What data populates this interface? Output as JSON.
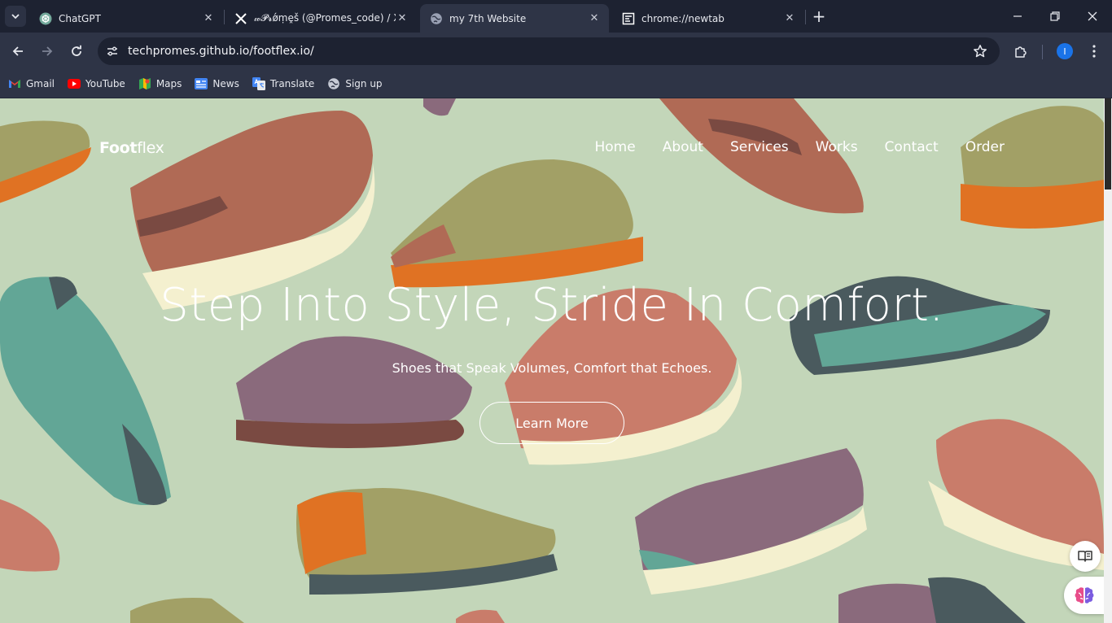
{
  "tabs": [
    {
      "title": "ChatGPT",
      "icon": "chatgpt-icon"
    },
    {
      "title": "𝓌𝓟𝓻ǿṃḙṧ (@Promes_code) / X",
      "icon": "x-logo-icon"
    },
    {
      "title": "my 7th Website",
      "icon": "globe-icon",
      "active": true
    },
    {
      "title": "chrome://newtab",
      "icon": "newtab-icon"
    }
  ],
  "address_bar": {
    "url": "techpromes.github.io/footflex.io/"
  },
  "profile": {
    "initial": "I"
  },
  "bookmarks": [
    {
      "label": "Gmail",
      "icon": "gmail-icon"
    },
    {
      "label": "YouTube",
      "icon": "youtube-icon"
    },
    {
      "label": "Maps",
      "icon": "maps-icon"
    },
    {
      "label": "News",
      "icon": "news-icon"
    },
    {
      "label": "Translate",
      "icon": "translate-icon"
    },
    {
      "label": "Sign up",
      "icon": "globe-icon"
    }
  ],
  "site": {
    "logo_bold": "Foot",
    "logo_light": "flex",
    "nav": [
      "Home",
      "About",
      "Services",
      "Works",
      "Contact",
      "Order"
    ],
    "hero_title": "Step Into Style, Stride In Comfort.",
    "hero_subtitle": "Shoes that Speak Volumes, Comfort that Echoes.",
    "cta_label": "Learn More"
  },
  "colors": {
    "background": "#c3d6b9",
    "accent_orange": "#e07223",
    "shoe_brown": "#b06a55",
    "shoe_teal": "#62a696",
    "shoe_purple": "#8a6a7c",
    "shoe_olive": "#a2a066"
  }
}
